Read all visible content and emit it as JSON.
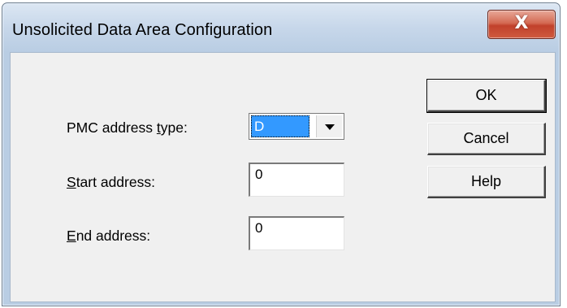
{
  "page_top_text": "",
  "window": {
    "title": "Unsolicited Data Area Configuration",
    "close_label": "X"
  },
  "form": {
    "pmc_address_type": {
      "label_pre": "PMC address ",
      "label_accel": "t",
      "label_post": "ype:",
      "value": "D"
    },
    "start_address": {
      "label_accel": "S",
      "label_post": "tart address:",
      "value": "0"
    },
    "end_address": {
      "label_accel": "E",
      "label_post": "nd address:",
      "value": "0"
    }
  },
  "buttons": {
    "ok": "OK",
    "cancel": "Cancel",
    "help": "Help"
  },
  "icons": {
    "close": "close-icon",
    "dropdown": "chevron-down-icon"
  },
  "colors": {
    "selection": "#3399ff",
    "close_button": "#c1412b",
    "title_bar": "#b9cde3",
    "dialog_background": "#f0f0f0"
  }
}
